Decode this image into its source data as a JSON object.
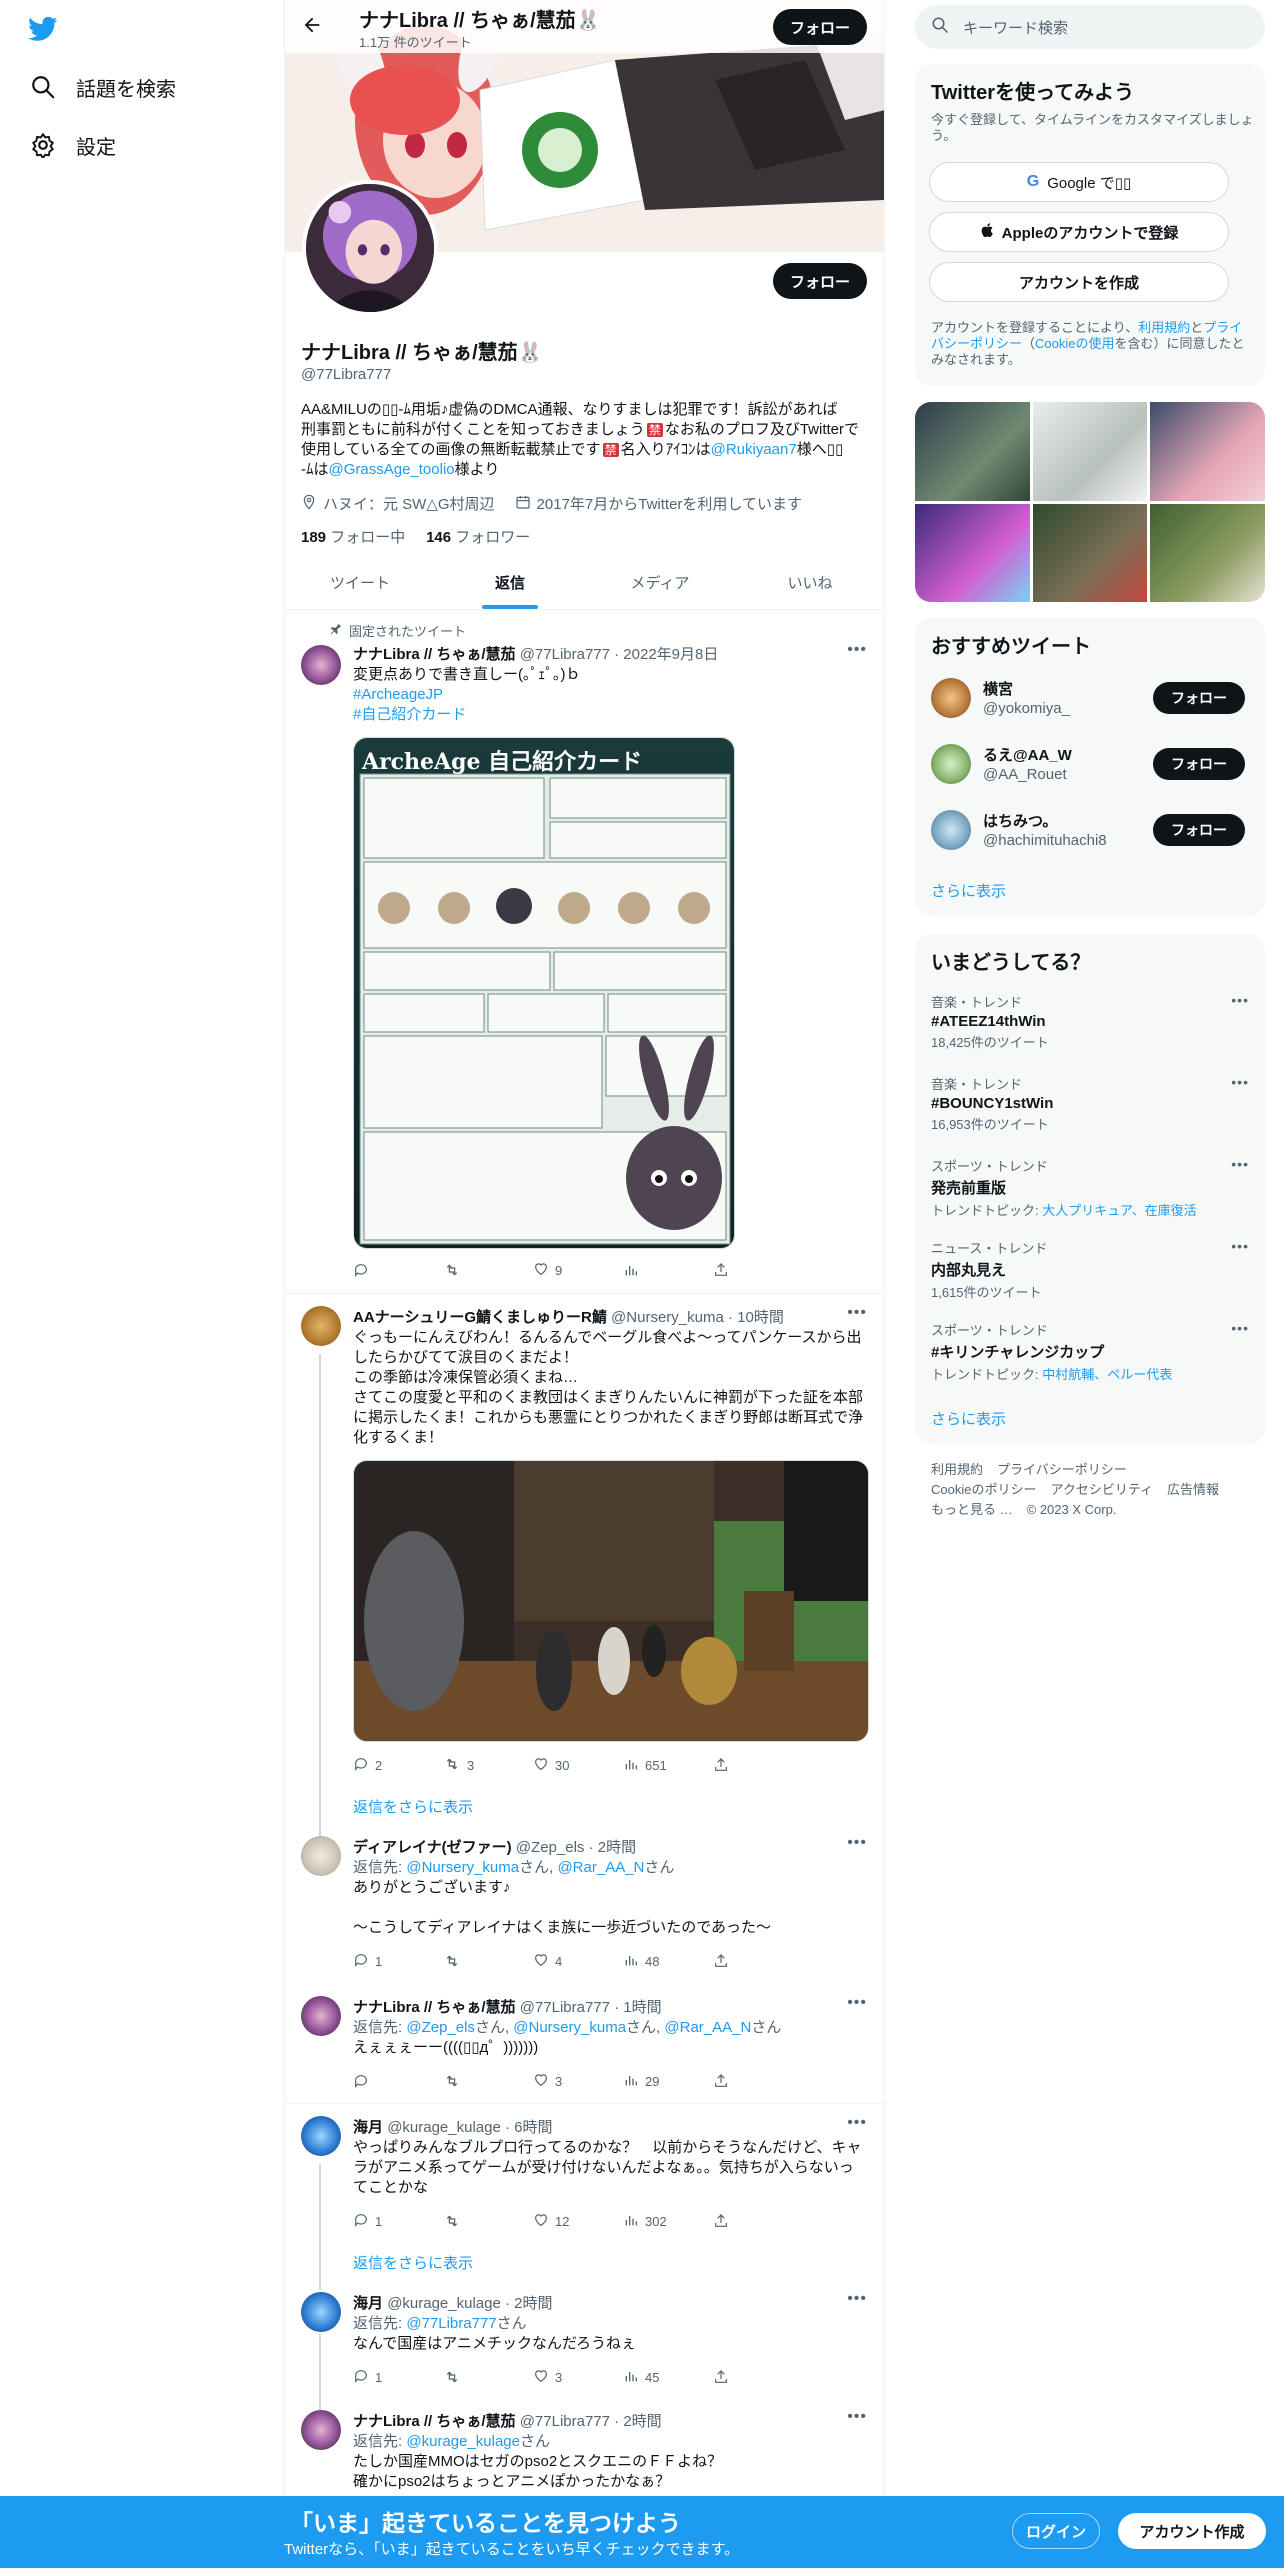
{
  "nav": {
    "explore_label": "話題を検索",
    "settings_label": "設定"
  },
  "header": {
    "name": "ナナLibra // ちゃぁ/慧茄🐰",
    "tweet_count": "1.1万 件のツイート",
    "follow_label": "フォロー"
  },
  "profile": {
    "name": "ナナLibra // ちゃぁ/慧茄🐰",
    "handle": "@77Libra777",
    "bio_line1": "AA&MILUの▯▯-ﾑ用垢♪虚偽のDMCA通報、なりすましは犯罪です！訴訟があれば",
    "bio_line2": "刑事罰ともに前科が付くことを知っておきましょう",
    "bio_line2b": "なお私のプロフ及びTwitterで",
    "bio_line3": "使用している全ての画像の無断転載禁止です",
    "bio_line3b": "名入りｱｲｺﾝは",
    "bio_link1": "@Rukiyaan7",
    "bio_line3c": "様へ▯▯",
    "bio_line4a": "-ﾑは",
    "bio_link2": "@GrassAge_toolio",
    "bio_line4b": "様より",
    "location": "ハヌイ：元 SW△G村周辺",
    "joined": "2017年7月からTwitterを利用しています",
    "following_count": "189",
    "following_label": "フォロー中",
    "followers_count": "146",
    "followers_label": "フォロワー",
    "follow_label": "フォロー"
  },
  "tabs": [
    "ツイート",
    "返信",
    "メディア",
    "いいね"
  ],
  "tweets": {
    "pinned_label": "固定されたツイート",
    "t1": {
      "name": "ナナLibra // ちゃぁ/慧茄",
      "handle": "@77Libra777 · 2022年9月8日",
      "text": "変更点ありで書き直しー(｡ﾟｪﾟ｡)ｂ",
      "tag1": "#ArcheageJP",
      "tag2": "#自己紹介カード",
      "card_title": "ArcheAge 自己紹介カード",
      "likes": "9"
    },
    "t2": {
      "name": "AAナーシュリーG鯖くましゅりーR鯖",
      "handle": "@Nursery_kuma · 10時間",
      "text1": "ぐっもーにんえびわん！るんるんでベーグル食べよ〜ってパンケースから出",
      "text2": "したらかびてて涙目のくまだよ！",
      "text3": "この季節は冷凍保管必須くまね…",
      "text4": "さてこの度愛と平和のくま教団はくまぎりんたいんに神罰が下った証を本部",
      "text5": "に掲示したくま！これからも悪霊にとりつかれたくまぎり野郎は断耳式で浄",
      "text6": "化するくま！",
      "replies": "2",
      "retweets": "3",
      "likes": "30",
      "views": "651"
    },
    "show_replies_1": "返信をさらに表示",
    "t3": {
      "name": "ディアレイナ(ゼファー)",
      "handle": "@Zep_els · 2時間",
      "reply_prefix": "返信先: ",
      "reply_to1": "@Nursery_kuma",
      "reply_san1": "さん, ",
      "reply_to2": "@Rar_AA_N",
      "reply_san2": "さん",
      "text1": "ありがとうございます♪",
      "text2": "〜こうしてディアレイナはくま族に一歩近づいたのであった〜",
      "replies": "1",
      "likes": "4",
      "views": "48"
    },
    "t4": {
      "name": "ナナLibra // ちゃぁ/慧茄",
      "handle": "@77Libra777 · 1時間",
      "reply_prefix": "返信先: ",
      "reply_to1": "@Zep_els",
      "reply_to2": "@Nursery_kuma",
      "reply_to3": "@Rar_AA_N",
      "san": "さん",
      "sanc": "さん, ",
      "text": "えぇぇぇーー((((▯▯д゜)))))))",
      "likes": "3",
      "views": "29"
    },
    "t5": {
      "name": "海月",
      "handle": "@kurage_kulage · 6時間",
      "text1": "やっぱりみんなブルプロ行ってるのかな？　以前からそうなんだけど、キャ",
      "text2": "ラがアニメ系ってゲームが受け付けないんだよなぁ。。気持ちが入らないっ",
      "text3": "てことかな",
      "replies": "1",
      "likes": "12",
      "views": "302"
    },
    "show_replies_2": "返信をさらに表示",
    "t6": {
      "name": "海月",
      "handle": "@kurage_kulage · 2時間",
      "reply_prefix": "返信先: ",
      "reply_to1": "@77Libra777",
      "san": "さん",
      "text": "なんで国産はアニメチックなんだろうねぇ",
      "replies": "1",
      "likes": "3",
      "views": "45"
    },
    "t7": {
      "name": "ナナLibra // ちゃぁ/慧茄",
      "handle": "@77Libra777 · 2時間",
      "reply_prefix": "返信先: ",
      "reply_to1": "@kurage_kulage",
      "san": "さん",
      "text1": "たしか国産MMOはセガのpso2とスクエニのＦＦよね？",
      "text2": "確かにpso2はちょっとアニメぽかったかなぁ？"
    }
  },
  "right": {
    "search_placeholder": "キーワード検索",
    "signup_title": "Twitterを使ってみよう",
    "signup_sub": "今すぐ登録して、タイムラインをカスタマイズしましょう。",
    "google_btn": "Google で▯▯",
    "apple_btn": "Appleのアカウントで登録",
    "create_btn": "アカウントを作成",
    "terms1": "アカウントを登録することにより、",
    "terms_link1": "利用規約",
    "terms2": "と",
    "terms_link2": "プライバシーポリシー",
    "terms3": "（",
    "terms_link3": "Cookieの使用",
    "terms4": "を含む）に同意したとみなされます。",
    "rec_title": "おすすめツイート",
    "recs": [
      {
        "name": "横宮",
        "handle": "@yokomiya_",
        "btn": "フォロー"
      },
      {
        "name": "るえ@AA_W",
        "handle": "@AA_Rouet",
        "btn": "フォロー"
      },
      {
        "name": "はちみつ。",
        "handle": "@hachimituhachi8",
        "btn": "フォロー"
      }
    ],
    "show_more": "さらに表示",
    "trends_title": "いまどうしてる？",
    "trends": [
      {
        "cat": "音楽・トレンド",
        "title": "#ATEEZ14thWin",
        "sub": "18,425件のツイート"
      },
      {
        "cat": "音楽・トレンド",
        "title": "#BOUNCY1stWin",
        "sub": "16,953件のツイート"
      },
      {
        "cat": "スポーツ・トレンド",
        "title": "発売前重版",
        "sub_prefix": "トレンドトピック: ",
        "sub_link": "大人プリキュア、在庫復活"
      },
      {
        "cat": "ニュース・トレンド",
        "title": "内部丸見え",
        "sub": "1,615件のツイート"
      },
      {
        "cat": "スポーツ・トレンド",
        "title": "#キリンチャレンジカップ",
        "sub_prefix": "トレンドトピック: ",
        "sub_link": "中村航輔、ペルー代表"
      }
    ],
    "trends_more": "さらに表示",
    "footer": [
      "利用規約",
      "プライバシーポリシー",
      "Cookieのポリシー",
      "アクセシビリティ",
      "広告情報",
      "もっと見る …",
      "© 2023 X Corp."
    ]
  },
  "bottom": {
    "title": "「いま」起きていることを見つけよう",
    "sub": "Twitterなら、「いま」起きていることをいち早くチェックできます。",
    "login": "ログイン",
    "signup": "アカウント作成"
  },
  "colors": {
    "accent": "#1d9bf0",
    "dark": "#0f1419",
    "muted": "#536471"
  }
}
